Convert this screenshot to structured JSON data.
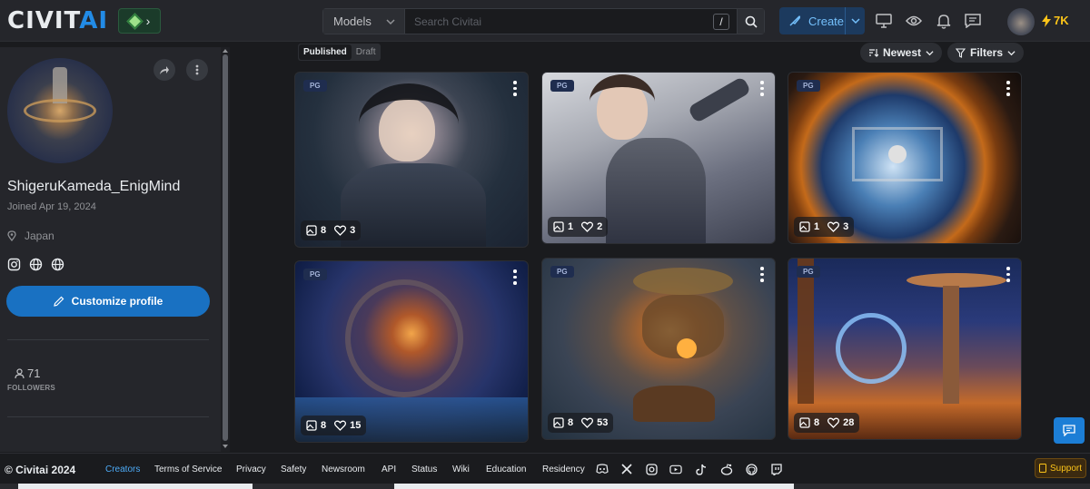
{
  "header": {
    "logo_main": "CIVIT",
    "logo_accent": "AI",
    "search_category": "Models",
    "search_placeholder": "Search Civitai",
    "search_shortcut": "/",
    "create_label": "Create",
    "credits": "7K"
  },
  "profile": {
    "username": "ShigeruKameda_EnigMind",
    "joined": "Joined Apr 19, 2024",
    "location": "Japan",
    "customize_label": "Customize profile",
    "followers_count": "71",
    "followers_label": "FOLLOWERS"
  },
  "gallery": {
    "tabs": [
      {
        "label": "Published"
      },
      {
        "label": "Draft"
      }
    ],
    "sort_label": "Newest",
    "filters_label": "Filters",
    "cards": [
      {
        "rating": "PG",
        "images": "8",
        "likes": "3",
        "subject": "woman in dark armor"
      },
      {
        "rating": "PG",
        "images": "1",
        "likes": "2",
        "subject": "woman in grey spacesuit"
      },
      {
        "rating": "PG",
        "images": "1",
        "likes": "3",
        "subject": "space station through porthole"
      },
      {
        "rating": "PG",
        "images": "8",
        "likes": "15",
        "subject": "spherical spaceship over planet"
      },
      {
        "rating": "PG",
        "images": "8",
        "likes": "53",
        "subject": "mushroom city on floating islands"
      },
      {
        "rating": "PG",
        "images": "8",
        "likes": "28",
        "subject": "alien tower with portal"
      }
    ]
  },
  "footer": {
    "copyright": "© Civitai 2024",
    "links": [
      "Creators",
      "Terms of Service",
      "Privacy",
      "Safety",
      "Newsroom",
      "API",
      "Status",
      "Wiki",
      "Education",
      "Residency"
    ],
    "support_label": "Support"
  },
  "colors": {
    "accent": "#228be6",
    "credits": "#fcc419",
    "background": "#1a1b1e",
    "panel": "#25262b"
  }
}
